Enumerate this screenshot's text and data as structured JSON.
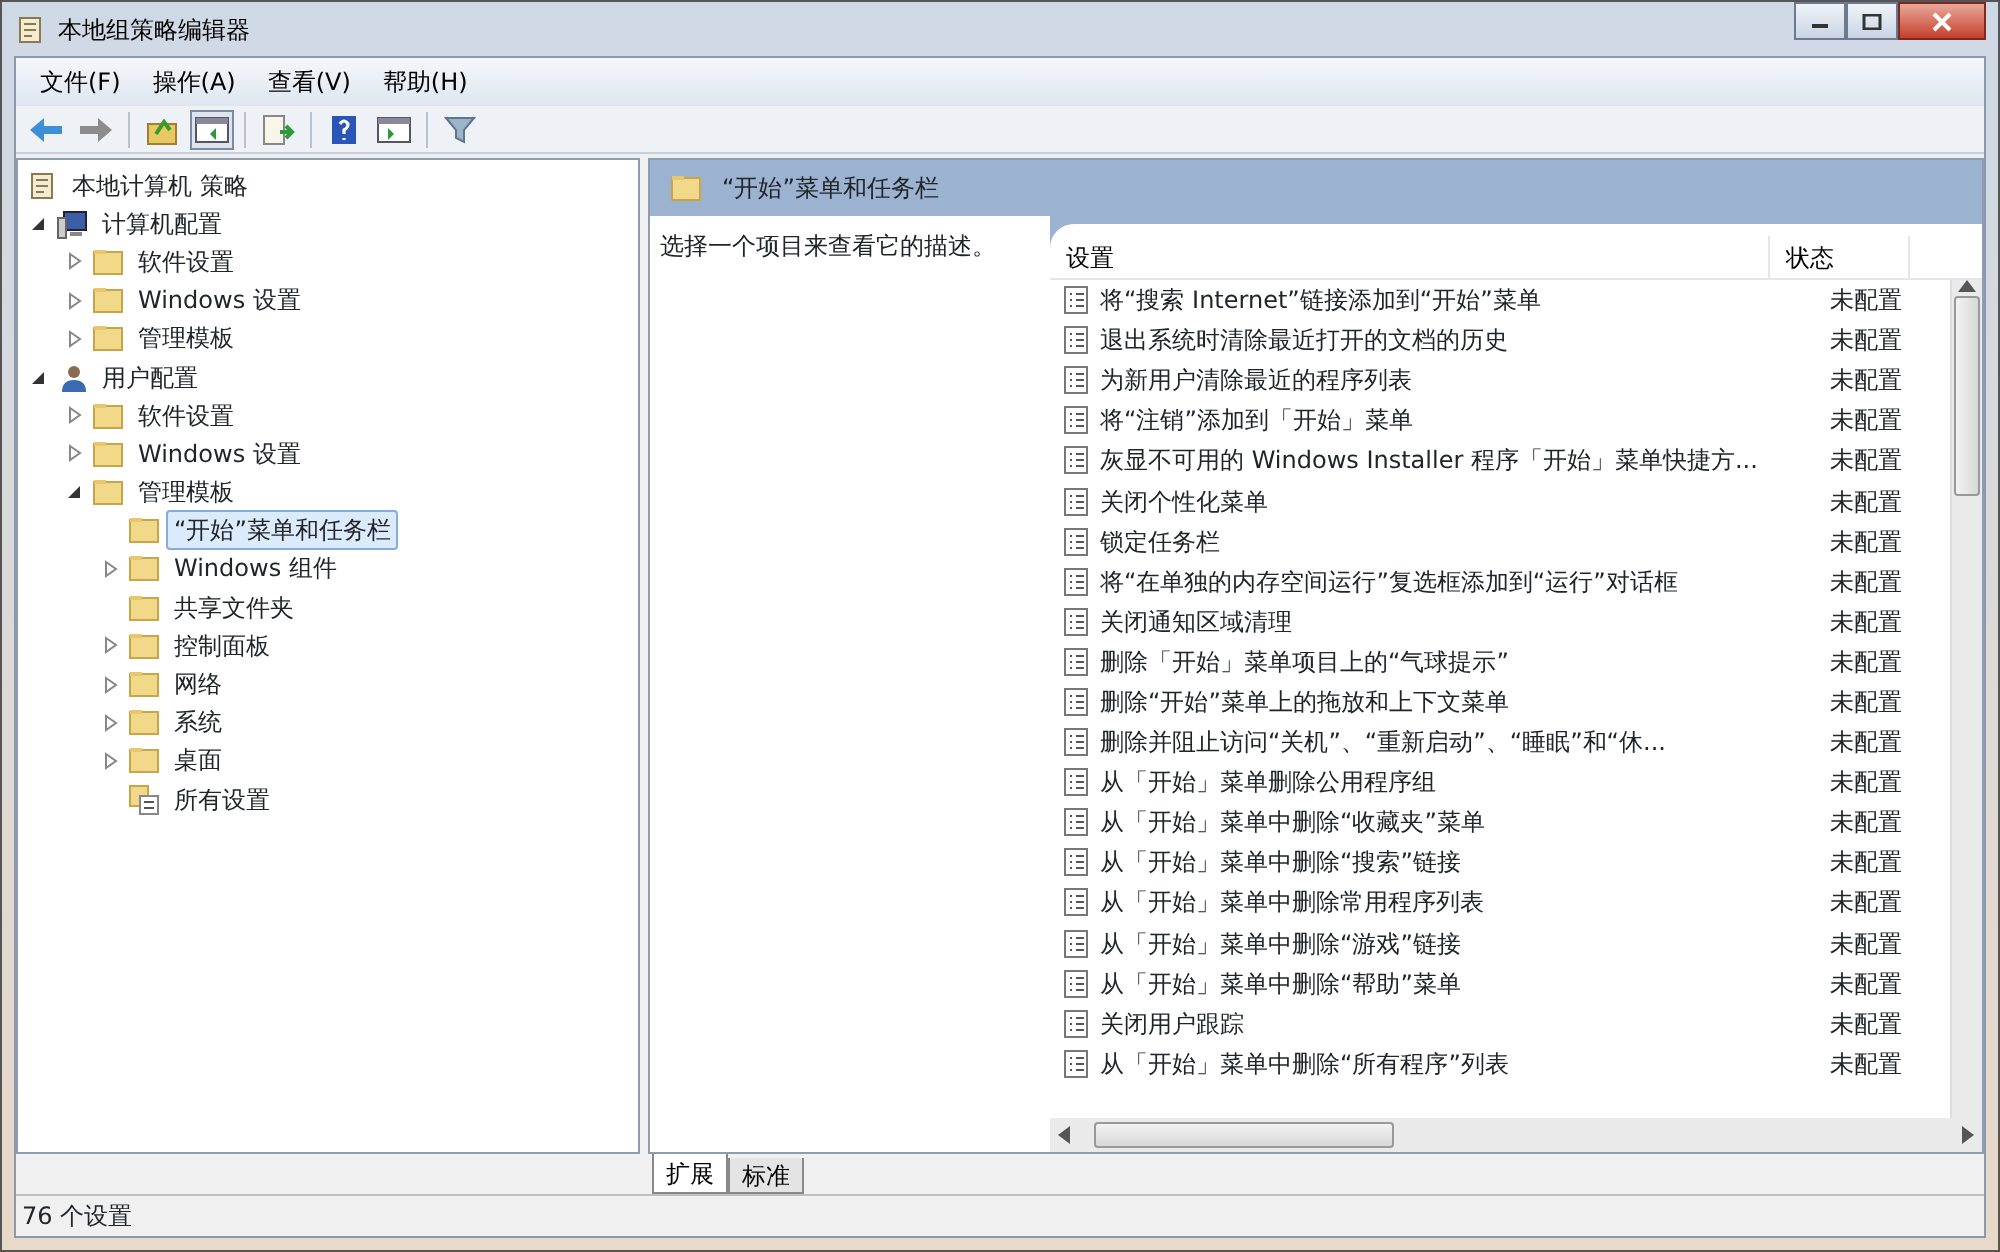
{
  "window": {
    "title": "本地组策略编辑器"
  },
  "menu": [
    "文件(F)",
    "操作(A)",
    "查看(V)",
    "帮助(H)"
  ],
  "tree": {
    "label": "本地计算机 策略",
    "children": [
      {
        "label": "计算机配置",
        "kind": "computer",
        "expanded": true,
        "selected": false,
        "children": [
          {
            "label": "软件设置",
            "kind": "folder",
            "expanded": false,
            "selected": false
          },
          {
            "label": "Windows 设置",
            "kind": "folder",
            "expanded": false,
            "selected": false
          },
          {
            "label": "管理模板",
            "kind": "folder",
            "expanded": false,
            "selected": false
          }
        ]
      },
      {
        "label": "用户配置",
        "kind": "user",
        "expanded": true,
        "selected": false,
        "children": [
          {
            "label": "软件设置",
            "kind": "folder",
            "expanded": false,
            "selected": false
          },
          {
            "label": "Windows 设置",
            "kind": "folder",
            "expanded": false,
            "selected": false
          },
          {
            "label": "管理模板",
            "kind": "folder",
            "expanded": true,
            "selected": false,
            "children": [
              {
                "label": "“开始”菜单和任务栏",
                "kind": "folder",
                "selected": true
              },
              {
                "label": "Windows 组件",
                "kind": "folder",
                "expanded": false,
                "selected": false
              },
              {
                "label": "共享文件夹",
                "kind": "folder",
                "selected": false
              },
              {
                "label": "控制面板",
                "kind": "folder",
                "expanded": false,
                "selected": false
              },
              {
                "label": "网络",
                "kind": "folder",
                "expanded": false,
                "selected": false
              },
              {
                "label": "系统",
                "kind": "folder",
                "expanded": false,
                "selected": false
              },
              {
                "label": "桌面",
                "kind": "folder",
                "expanded": false,
                "selected": false
              },
              {
                "label": "所有设置",
                "kind": "settings",
                "selected": false
              }
            ]
          }
        ]
      }
    ]
  },
  "detail": {
    "title": "“开始”菜单和任务栏",
    "description": "选择一个项目来查看它的描述。",
    "columns": [
      "设置",
      "状态"
    ],
    "rows": [
      {
        "setting": "将“搜索 Internet”链接添加到“开始”菜单",
        "state": "未配置"
      },
      {
        "setting": "退出系统时清除最近打开的文档的历史",
        "state": "未配置"
      },
      {
        "setting": "为新用户清除最近的程序列表",
        "state": "未配置"
      },
      {
        "setting": "将“注销”添加到「开始」菜单",
        "state": "未配置"
      },
      {
        "setting": "灰显不可用的 Windows Installer 程序「开始」菜单快捷方...",
        "state": "未配置"
      },
      {
        "setting": "关闭个性化菜单",
        "state": "未配置"
      },
      {
        "setting": "锁定任务栏",
        "state": "未配置"
      },
      {
        "setting": "将“在单独的内存空间运行”复选框添加到“运行”对话框",
        "state": "未配置"
      },
      {
        "setting": "关闭通知区域清理",
        "state": "未配置"
      },
      {
        "setting": "删除「开始」菜单项目上的“气球提示”",
        "state": "未配置"
      },
      {
        "setting": "删除“开始”菜单上的拖放和上下文菜单",
        "state": "未配置"
      },
      {
        "setting": "删除并阻止访问“关机”、“重新启动”、“睡眠”和“休...",
        "state": "未配置"
      },
      {
        "setting": "从「开始」菜单删除公用程序组",
        "state": "未配置"
      },
      {
        "setting": "从「开始」菜单中删除“收藏夹”菜单",
        "state": "未配置"
      },
      {
        "setting": "从「开始」菜单中删除“搜索”链接",
        "state": "未配置"
      },
      {
        "setting": "从「开始」菜单中删除常用程序列表",
        "state": "未配置"
      },
      {
        "setting": "从「开始」菜单中删除“游戏”链接",
        "state": "未配置"
      },
      {
        "setting": "从「开始」菜单中删除“帮助”菜单",
        "state": "未配置"
      },
      {
        "setting": "关闭用户跟踪",
        "state": "未配置"
      },
      {
        "setting": "从「开始」菜单中删除“所有程序”列表",
        "state": "未配置"
      }
    ]
  },
  "tabs": [
    {
      "label": "扩展",
      "selected": true
    },
    {
      "label": "标准",
      "selected": false
    }
  ],
  "status_bar": "76 个设置"
}
